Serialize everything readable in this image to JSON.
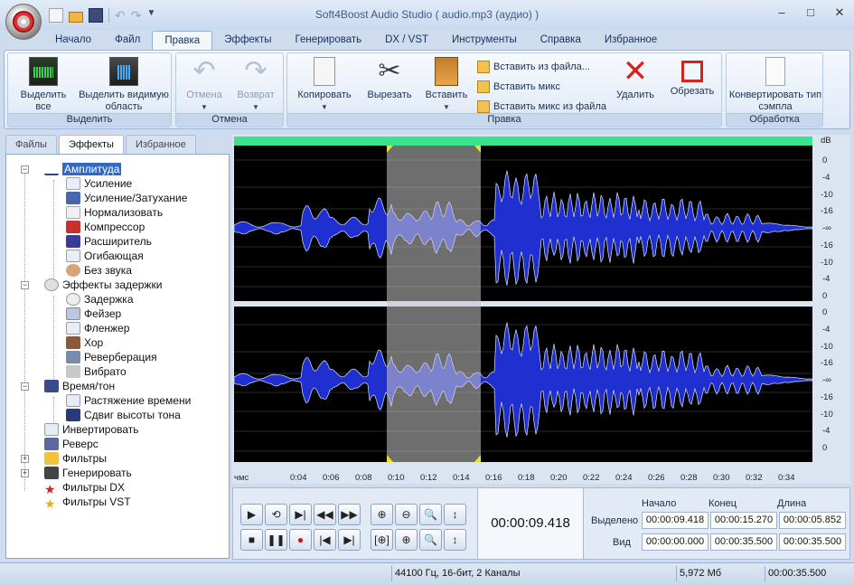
{
  "window": {
    "title": "Soft4Boost Audio Studio  ( audio.mp3 (аудио) )"
  },
  "ribbon_tabs": [
    "Начало",
    "Файл",
    "Правка",
    "Эффекты",
    "Генерировать",
    "DX / VST",
    "Инструменты",
    "Справка",
    "Избранное"
  ],
  "active_tab": "Правка",
  "groups": {
    "select": {
      "label": "Выделить",
      "select_all": "Выделить все",
      "select_view": "Выделить видимую область"
    },
    "undo": {
      "label": "Отмена",
      "undo": "Отмена",
      "redo": "Возврат"
    },
    "edit": {
      "label": "Правка",
      "copy": "Копировать",
      "cut": "Вырезать",
      "paste": "Вставить",
      "paste_from_file": "Вставить из файла...",
      "paste_mix": "Вставить микс",
      "paste_mix_from_file": "Вставить микс из файла",
      "delete": "Удалить",
      "crop": "Обрезать"
    },
    "process": {
      "label": "Обработка",
      "convert": "Конвертировать тип сэмпла"
    }
  },
  "left_tabs": [
    "Файлы",
    "Эффекты",
    "Избранное"
  ],
  "active_left_tab": "Эффекты",
  "tree": {
    "amplitude": "Амплитуда",
    "amplitude_items": [
      "Усиление",
      "Усиление/Затухание",
      "Нормализовать",
      "Компрессор",
      "Расширитель",
      "Огибающая",
      "Без звука"
    ],
    "delay": "Эффекты задержки",
    "delay_items": [
      "Задержка",
      "Фейзер",
      "Фленжер",
      "Хор",
      "Реверберация",
      "Вибрато"
    ],
    "time": "Время/тон",
    "time_items": [
      "Растяжение времени",
      "Сдвиг высоты тона"
    ],
    "invert": "Инвертировать",
    "reverse": "Реверс",
    "filters": "Фильтры",
    "generate": "Генерировать",
    "dx": "Фильтры DX",
    "vst": "Фильтры VST"
  },
  "db_scale": {
    "unit": "dB",
    "ticks": [
      "0",
      "-4",
      "-10",
      "-16",
      "-∞",
      "-16",
      "-10",
      "-4",
      "0"
    ]
  },
  "ruler": {
    "unit": "чмс",
    "ticks": [
      "0:04",
      "0:06",
      "0:08",
      "0:10",
      "0:12",
      "0:14",
      "0:16",
      "0:18",
      "0:20",
      "0:22",
      "0:24",
      "0:26",
      "0:28",
      "0:30",
      "0:32",
      "0:34"
    ]
  },
  "transport": {
    "current_time": "00:00:09.418",
    "col_start": "Начало",
    "col_end": "Конец",
    "col_length": "Длина",
    "row_selected": "Выделено",
    "row_view": "Вид",
    "sel_start": "00:00:09.418",
    "sel_end": "00:00:15.270",
    "sel_length": "00:00:05.852",
    "view_start": "00:00:00.000",
    "view_end": "00:00:35.500",
    "view_length": "00:00:35.500"
  },
  "status": {
    "format": "44100 Гц, 16-бит, 2 Каналы",
    "size": "5,972 Мб",
    "duration": "00:00:35.500"
  },
  "colors": {
    "waveform": "#1f2fd0",
    "selection": "#8a8a8a",
    "timeline": "#3be38d",
    "tree_selection": "#316ac5"
  }
}
